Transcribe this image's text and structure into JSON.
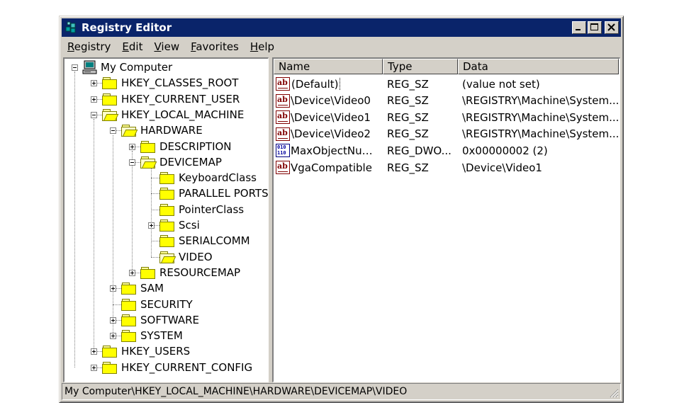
{
  "window": {
    "title": "Registry Editor",
    "controls": {
      "minimize": "minimize",
      "maximize": "maximize",
      "close": "close"
    }
  },
  "menubar": {
    "items": [
      {
        "label": "Registry",
        "accel": "R",
        "rest": "egistry"
      },
      {
        "label": "Edit",
        "accel": "E",
        "rest": "dit"
      },
      {
        "label": "View",
        "accel": "V",
        "rest": "iew"
      },
      {
        "label": "Favorites",
        "accel": "F",
        "rest": "avorites"
      },
      {
        "label": "Help",
        "accel": "H",
        "rest": "elp"
      }
    ]
  },
  "tree": {
    "root": "My Computer",
    "items": [
      {
        "label": "HKEY_CLASSES_ROOT",
        "level": 1,
        "expander": "plus"
      },
      {
        "label": "HKEY_CURRENT_USER",
        "level": 1,
        "expander": "plus"
      },
      {
        "label": "HKEY_LOCAL_MACHINE",
        "level": 1,
        "expander": "minus",
        "open": true
      },
      {
        "label": "HARDWARE",
        "level": 2,
        "expander": "minus",
        "open": true
      },
      {
        "label": "DESCRIPTION",
        "level": 3,
        "expander": "plus"
      },
      {
        "label": "DEVICEMAP",
        "level": 3,
        "expander": "minus",
        "open": true
      },
      {
        "label": "KeyboardClass",
        "level": 4,
        "expander": "none"
      },
      {
        "label": "PARALLEL PORTS",
        "level": 4,
        "expander": "none"
      },
      {
        "label": "PointerClass",
        "level": 4,
        "expander": "none"
      },
      {
        "label": "Scsi",
        "level": 4,
        "expander": "plus"
      },
      {
        "label": "SERIALCOMM",
        "level": 4,
        "expander": "none"
      },
      {
        "label": "VIDEO",
        "level": 4,
        "expander": "none",
        "open": true,
        "selected": true
      },
      {
        "label": "RESOURCEMAP",
        "level": 3,
        "expander": "plus"
      },
      {
        "label": "SAM",
        "level": 2,
        "expander": "plus"
      },
      {
        "label": "SECURITY",
        "level": 2,
        "expander": "none"
      },
      {
        "label": "SOFTWARE",
        "level": 2,
        "expander": "plus"
      },
      {
        "label": "SYSTEM",
        "level": 2,
        "expander": "plus"
      },
      {
        "label": "HKEY_USERS",
        "level": 1,
        "expander": "plus"
      },
      {
        "label": "HKEY_CURRENT_CONFIG",
        "level": 1,
        "expander": "plus"
      }
    ]
  },
  "list": {
    "columns": {
      "name": "Name",
      "type": "Type",
      "data": "Data"
    },
    "rows": [
      {
        "icon": "string-value-icon",
        "name": "(Default)",
        "type": "REG_SZ",
        "data": "(value not set)"
      },
      {
        "icon": "string-value-icon",
        "name": "\\Device\\Video0",
        "type": "REG_SZ",
        "data": "\\REGISTRY\\Machine\\System..."
      },
      {
        "icon": "string-value-icon",
        "name": "\\Device\\Video1",
        "type": "REG_SZ",
        "data": "\\REGISTRY\\Machine\\System..."
      },
      {
        "icon": "string-value-icon",
        "name": "\\Device\\Video2",
        "type": "REG_SZ",
        "data": "\\REGISTRY\\Machine\\System..."
      },
      {
        "icon": "binary-value-icon",
        "name": "MaxObjectNumber",
        "type": "REG_DWO...",
        "data": "0x00000002 (2)"
      },
      {
        "icon": "string-value-icon",
        "name": "VgaCompatible",
        "type": "REG_SZ",
        "data": "\\Device\\Video1"
      }
    ]
  },
  "statusbar": {
    "path": "My Computer\\HKEY_LOCAL_MACHINE\\HARDWARE\\DEVICEMAP\\VIDEO"
  },
  "colors": {
    "titlebar": "#0a246a",
    "face": "#d4d0c8",
    "folder": "#ffff00"
  }
}
